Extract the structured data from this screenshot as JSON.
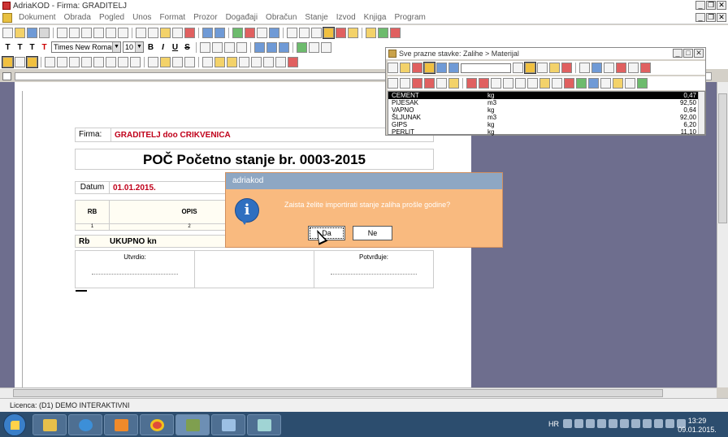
{
  "window": {
    "title": "AdriaKOD - Firma: GRADITELJ"
  },
  "menu": [
    "Dokument",
    "Obrada",
    "Pogled",
    "Unos",
    "Format",
    "Prozor",
    "Događaji",
    "Obračun",
    "Stanje",
    "Izvod",
    "Knjiga",
    "Program"
  ],
  "format_toolbar": {
    "font": "Times New Roman",
    "size": "10"
  },
  "document": {
    "firma_label": "Firma:",
    "firma_name": "GRADITELJ doo CRIKVENICA",
    "title": "POČ Početno stanje br. 0003-2015",
    "datum_label": "Datum",
    "datum_value": "01.01.2015.",
    "columns": {
      "rb": "RB",
      "opis": "OPIS"
    },
    "column_numbers": [
      "1",
      "2"
    ],
    "total": {
      "rb": "Rb",
      "label": "UKUPNO kn"
    },
    "signatures": {
      "left": "Utvrdio:",
      "right": "Potvrđuje:"
    }
  },
  "panel": {
    "title": "Sve prazne stavke:  Zalihe > Materijal",
    "items": [
      {
        "name": "CEMENT",
        "unit": "kg",
        "price": "0,47",
        "selected": true
      },
      {
        "name": "PIJESAK",
        "unit": "m3",
        "price": "92,50"
      },
      {
        "name": "VAPNO",
        "unit": "kg",
        "price": "0,64"
      },
      {
        "name": "ŠLJUNAK",
        "unit": "m3",
        "price": "92,00"
      },
      {
        "name": "GIPS",
        "unit": "kg",
        "price": "6,20"
      },
      {
        "name": "PERLIT",
        "unit": "kg",
        "price": "11,10"
      }
    ]
  },
  "dialog": {
    "title": "adriakod",
    "message": "Zaista želite importirati stanje zaliha prošle godine?",
    "yes": "Da",
    "no": "Ne"
  },
  "statusbar": {
    "text": "Licenca: (D1) DEMO INTERAKTIVNI"
  },
  "taskbar": {
    "apps": [
      "explorer",
      "internet-explorer",
      "media-player",
      "chrome",
      "adriakod",
      "app-6",
      "app-7"
    ],
    "lang": "HR",
    "time": "13:29",
    "date": "09.01.2015."
  },
  "colors": {
    "dialog_bg": "#f9ba7f",
    "dialog_title": "#8ea7c3",
    "accent_red": "#c0001a",
    "workspace": "#6e6e8e"
  }
}
